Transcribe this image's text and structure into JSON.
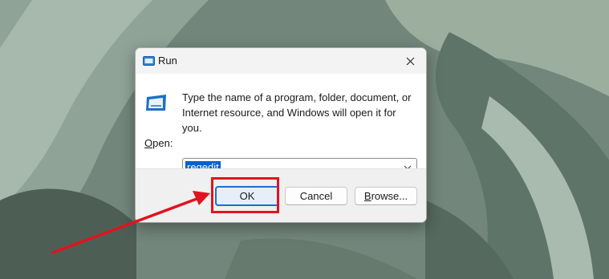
{
  "window": {
    "title": "Run",
    "icon": "run-app-icon",
    "close_icon": "close-icon"
  },
  "dialog": {
    "message": "Type the name of a program, folder, document, or Internet resource, and Windows will open it for you.",
    "open_label_mnemonic": "O",
    "open_label_rest": "pen:",
    "open_value": "regedit",
    "dropdown_icon": "chevron-down-icon"
  },
  "buttons": {
    "ok": "OK",
    "cancel": "Cancel",
    "browse_mnemonic": "B",
    "browse_rest": "rowse..."
  },
  "annotation": {
    "highlight_color": "#e0141e",
    "arrow_icon": "red-arrow-pointer"
  },
  "colors": {
    "selection": "#0060d0",
    "ok_border": "#1a6fd1"
  }
}
